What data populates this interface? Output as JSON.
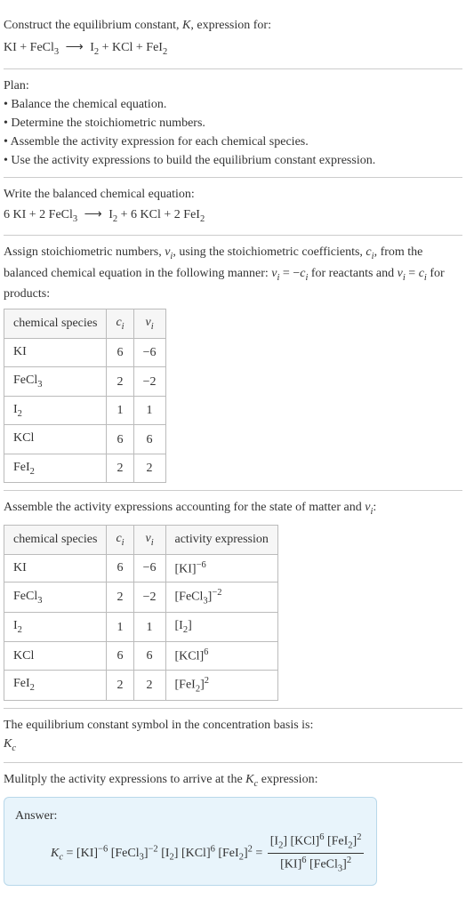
{
  "intro": {
    "line1_a": "Construct the equilibrium constant, ",
    "line1_k": "K",
    "line1_b": ", expression for:",
    "eq_lhs1": "KI + FeCl",
    "eq_lhs1_sub": "3",
    "eq_arrow": "⟶",
    "eq_rhs1": "I",
    "eq_rhs1_sub": "2",
    "eq_rhs2": " + KCl + FeI",
    "eq_rhs2_sub": "2"
  },
  "plan": {
    "title": "Plan:",
    "b1": "• Balance the chemical equation.",
    "b2": "• Determine the stoichiometric numbers.",
    "b3": "• Assemble the activity expression for each chemical species.",
    "b4": "• Use the activity expressions to build the equilibrium constant expression."
  },
  "balanced": {
    "title": "Write the balanced chemical equation:",
    "lhs1": "6 KI + 2 FeCl",
    "lhs1_sub": "3",
    "arrow": "⟶",
    "rhs1": "I",
    "rhs1_sub": "2",
    "rhs2": " + 6 KCl + 2 FeI",
    "rhs2_sub": "2"
  },
  "stoich": {
    "text_a": "Assign stoichiometric numbers, ",
    "nu": "ν",
    "i": "i",
    "text_b": ", using the stoichiometric coefficients, ",
    "c": "c",
    "text_c": ", from the balanced chemical equation in the following manner: ",
    "rel1a": "ν",
    "rel1b": " = −",
    "rel1c": "c",
    "text_d": " for reactants and ",
    "rel2": " = ",
    "text_e": " for products:",
    "headers": {
      "species": "chemical species",
      "ci": "c",
      "isub": "i",
      "nui": "ν"
    },
    "rows": [
      {
        "species": "KI",
        "sub": "",
        "ci": "6",
        "nui": "−6"
      },
      {
        "species": "FeCl",
        "sub": "3",
        "ci": "2",
        "nui": "−2"
      },
      {
        "species": "I",
        "sub": "2",
        "ci": "1",
        "nui": "1"
      },
      {
        "species": "KCl",
        "sub": "",
        "ci": "6",
        "nui": "6"
      },
      {
        "species": "FeI",
        "sub": "2",
        "ci": "2",
        "nui": "2"
      }
    ]
  },
  "activity": {
    "text_a": "Assemble the activity expressions accounting for the state of matter and ",
    "nu": "ν",
    "i": "i",
    "text_b": ":",
    "headers": {
      "species": "chemical species",
      "ci": "c",
      "isub": "i",
      "nui": "ν",
      "act": "activity expression"
    },
    "rows": [
      {
        "species": "KI",
        "sub": "",
        "ci": "6",
        "nui": "−6",
        "act_base": "[KI]",
        "act_sup": "−6",
        "act_sub": ""
      },
      {
        "species": "FeCl",
        "sub": "3",
        "ci": "2",
        "nui": "−2",
        "act_base": "[FeCl",
        "act_sup": "−2",
        "act_sub": "3",
        "act_close": "]"
      },
      {
        "species": "I",
        "sub": "2",
        "ci": "1",
        "nui": "1",
        "act_base": "[I",
        "act_sup": "",
        "act_sub": "2",
        "act_close": "]"
      },
      {
        "species": "KCl",
        "sub": "",
        "ci": "6",
        "nui": "6",
        "act_base": "[KCl]",
        "act_sup": "6",
        "act_sub": ""
      },
      {
        "species": "FeI",
        "sub": "2",
        "ci": "2",
        "nui": "2",
        "act_base": "[FeI",
        "act_sup": "2",
        "act_sub": "2",
        "act_close": "]"
      }
    ]
  },
  "kc_symbol": {
    "line": "The equilibrium constant symbol in the concentration basis is:",
    "k": "K",
    "c": "c"
  },
  "multiply": {
    "text_a": "Mulitply the activity expressions to arrive at the ",
    "k": "K",
    "c": "c",
    "text_b": " expression:"
  },
  "answer": {
    "label": "Answer:",
    "k": "K",
    "c": "c",
    "eq": " = ",
    "t1": "[KI]",
    "t1_sup": "−6",
    "t2a": " [FeCl",
    "t2sub": "3",
    "t2b": "]",
    "t2_sup": "−2",
    "t3a": " [I",
    "t3sub": "2",
    "t3b": "] ",
    "t4": "[KCl]",
    "t4_sup": "6",
    "t5a": " [FeI",
    "t5sub": "2",
    "t5b": "]",
    "t5_sup": "2",
    "eq2": " = ",
    "num1a": "[I",
    "num1sub": "2",
    "num1b": "] ",
    "num2": "[KCl]",
    "num2_sup": "6",
    "num3a": " [FeI",
    "num3sub": "2",
    "num3b": "]",
    "num3_sup": "2",
    "den1": "[KI]",
    "den1_sup": "6",
    "den2a": " [FeCl",
    "den2sub": "3",
    "den2b": "]",
    "den2_sup": "2"
  }
}
